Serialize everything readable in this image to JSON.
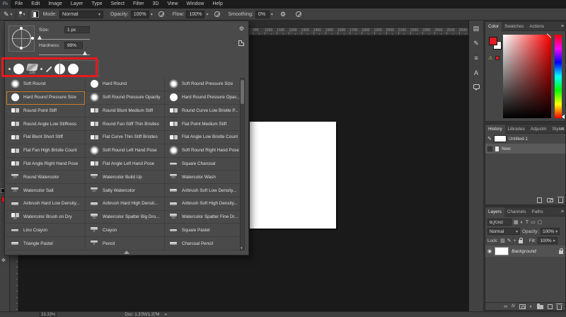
{
  "menubar": {
    "logo": "Ps",
    "items": [
      "File",
      "Edit",
      "Image",
      "Layer",
      "Type",
      "Select",
      "Filter",
      "3D",
      "View",
      "Window",
      "Help"
    ]
  },
  "options_bar": {
    "mode_label": "Mode:",
    "mode_value": "Normal",
    "opacity_label": "Opacity:",
    "opacity_value": "100%",
    "flow_label": "Flow:",
    "flow_value": "100%",
    "smoothing_label": "Smoothing:",
    "smoothing_value": "0%",
    "brush_size_indicator": "1"
  },
  "brush_panel": {
    "size_label": "Size:",
    "size_value": "1 px",
    "hardness_label": "Hardness:",
    "hardness_value": "99%",
    "recent": [
      {
        "type": "dot"
      },
      {
        "type": "circle"
      },
      {
        "type": "scatter",
        "num": "120"
      },
      {
        "type": "dot"
      },
      {
        "type": "stroke"
      },
      {
        "type": "circle"
      },
      {
        "type": "circle"
      }
    ],
    "columns": [
      {
        "items": [
          {
            "label": "Soft Round",
            "icon": "soft"
          },
          {
            "label": "Hard Round Pressure Size",
            "icon": "hard",
            "selected": true
          },
          {
            "label": "Round Point Stiff",
            "icon": "tip"
          },
          {
            "label": "Round Angle Low Stiffness",
            "icon": "tip"
          },
          {
            "label": "Flat Blunt Short Stiff",
            "icon": "tip"
          },
          {
            "label": "Flat Fan High Bristle Count",
            "icon": "tip"
          },
          {
            "label": "Flat Angle Right Hand Pose",
            "icon": "tip"
          },
          {
            "label": "Round Watercolor",
            "icon": "mark",
            "num": "25"
          },
          {
            "label": "Watercolor Salt",
            "icon": "mark",
            "num": "25"
          },
          {
            "label": "Airbrush Hard Low Density...",
            "icon": "mark"
          },
          {
            "label": "Watercolor Brush on Dry",
            "icon": "tip",
            "num": "36"
          },
          {
            "label": "Lino Crayon",
            "icon": "mark"
          },
          {
            "label": "Triangle Pastel",
            "icon": "mark"
          }
        ]
      },
      {
        "items": [
          {
            "label": "Hard Round",
            "icon": "hard"
          },
          {
            "label": "Soft Round Pressure Opacity",
            "icon": "soft"
          },
          {
            "label": "Round Blunt Medium Stiff",
            "icon": "tip"
          },
          {
            "label": "Round Fan Stiff Thin Bristles",
            "icon": "tip"
          },
          {
            "label": "Flat Curve Thin Stiff Bristles",
            "icon": "tip"
          },
          {
            "label": "Soft Round Left Hand Pose",
            "icon": "soft"
          },
          {
            "label": "Flat Angle Left Hand Pose",
            "icon": "tip"
          },
          {
            "label": "Watercolor Build Up",
            "icon": "mark",
            "num": "50"
          },
          {
            "label": "Salty Watercolor",
            "icon": "mark",
            "num": "50"
          },
          {
            "label": "Airbrush Hard High Densit...",
            "icon": "mark"
          },
          {
            "label": "Watercolor Spatter Big Dro...",
            "icon": "mark",
            "num": "30"
          },
          {
            "label": "Crayon",
            "icon": "mark",
            "num": "9"
          },
          {
            "label": "Pencil",
            "icon": "mark",
            "num": "9"
          }
        ]
      },
      {
        "items": [
          {
            "label": "Soft Round Pressure Size",
            "icon": "soft"
          },
          {
            "label": "Hard Round Pressure Opac...",
            "icon": "hard"
          },
          {
            "label": "Round Curve Low Bristle P...",
            "icon": "tip"
          },
          {
            "label": "Flat Point Medium Stiff",
            "icon": "tip"
          },
          {
            "label": "Flat Angle Low Bristle Count",
            "icon": "tip"
          },
          {
            "label": "Soft Round Right Hand Pose",
            "icon": "soft"
          },
          {
            "label": "Square Charcoal",
            "icon": "mark"
          },
          {
            "label": "Watercolor Wash",
            "icon": "mark",
            "num": "50"
          },
          {
            "label": "Airbrush Soft Low Density...",
            "icon": "mark"
          },
          {
            "label": "Airbrush Soft High Density...",
            "icon": "mark"
          },
          {
            "label": "Watercolor Spatter Fine Dr...",
            "icon": "mark",
            "num": "30"
          },
          {
            "label": "Square Pastel",
            "icon": "mark"
          },
          {
            "label": "Charcoal Pencil",
            "icon": "mark"
          }
        ]
      }
    ]
  },
  "rulers": {
    "h_labels": [
      "900",
      "1000",
      "1100",
      "1200",
      "1300",
      "1400",
      "1500",
      "1600",
      "1700",
      "1800",
      "1900",
      "2000",
      "2100",
      "2200",
      "2300",
      "2400",
      "2500",
      "2600"
    ]
  },
  "panels": {
    "color": {
      "tabs": [
        "Color",
        "Swatches",
        "Actions"
      ]
    },
    "history": {
      "tabs": [
        "History",
        "Libraries",
        "Adjustm",
        "Styles"
      ],
      "items": [
        {
          "label": "Untitled-1"
        },
        {
          "label": "New"
        }
      ]
    },
    "layers": {
      "tabs": [
        "Layers",
        "Channels",
        "Paths"
      ],
      "kind_value": "Kind",
      "blend_value": "Normal",
      "opacity_label": "Opacity:",
      "opacity_value": "100%",
      "lock_label": "Lock:",
      "fill_label": "Fill:",
      "fill_value": "100%",
      "layer_name": "Background",
      "fx_label": "fx"
    }
  },
  "status_bar": {
    "zoom": "33.33%",
    "doc_info": "Doc: 1.37M/1.37M"
  },
  "colors": {
    "foreground": "#e01b24",
    "selection_accent": "#d07a2e",
    "annotation_red": "#e8191c",
    "panel_bg": "#4a4a4a",
    "canvas_bg": "#1a1a1a"
  }
}
